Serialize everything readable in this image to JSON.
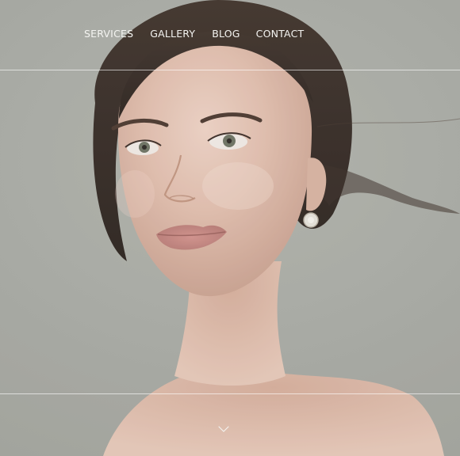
{
  "nav": {
    "items": [
      {
        "label": "SERVICES"
      },
      {
        "label": "GALLERY"
      },
      {
        "label": "BLOG"
      },
      {
        "label": "CONTACT"
      }
    ]
  },
  "hero": {
    "image": "portrait-photo",
    "scroll_icon": "chevron-down-icon"
  },
  "colors": {
    "background": "#a9aba4",
    "nav_text": "#f4f4f1",
    "divider": "#ffffff"
  }
}
